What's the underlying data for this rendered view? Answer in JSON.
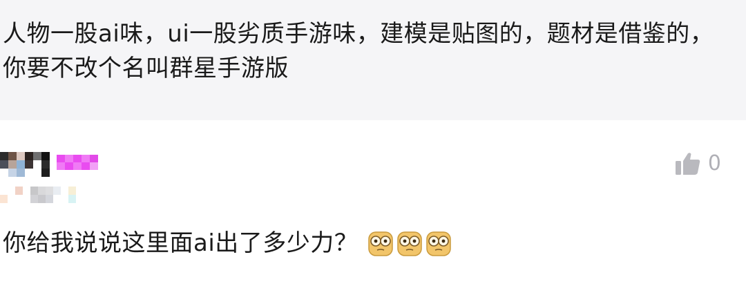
{
  "quoted_comment": {
    "text": "人物一股ai味，ui一股劣质手游味，建模是贴图的，题材是借鉴的，你要不改个名叫群星手游版"
  },
  "reply": {
    "like_count": "0",
    "text": "你给我说说这里面ai出了多少力？",
    "emojis": [
      "blank-stare-emoji",
      "blank-stare-emoji",
      "blank-stare-emoji"
    ]
  },
  "icons": {
    "like": "thumbs-up-icon"
  },
  "colors": {
    "quote_background": "#f5f5f7",
    "text": "#1a1a1a",
    "muted": "#b0b0b6",
    "username_accent": "#e94cf0",
    "emoji_fill": "#f2c56a"
  }
}
